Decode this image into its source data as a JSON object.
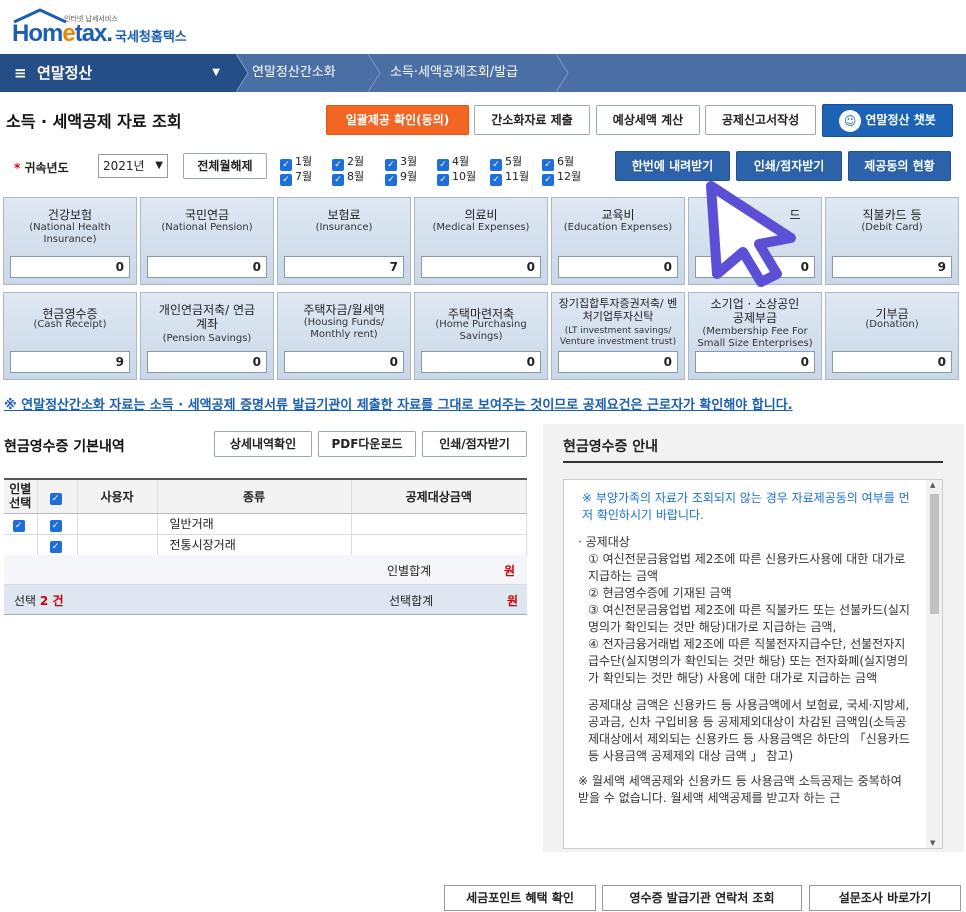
{
  "logo": {
    "brand_a": "Hom",
    "brand_e": "e",
    "brand_b": "tax.",
    "small": "인터넷 납세서비스",
    "kr": "국세청홈택스"
  },
  "nav": {
    "menu": "연말정산",
    "crumb1": "연말정산간소화",
    "crumb2": "소득·세액공제조회/발급"
  },
  "page": {
    "title": "소득 · 세액공제 자료 조회"
  },
  "top_buttons": {
    "consent": "일괄제공 확인(동의)",
    "submit": "간소화자료 제출",
    "estimate": "예상세액 계산",
    "form": "공제신고서작성",
    "chatbot": "연말정산 챗봇"
  },
  "filter": {
    "year_label": "귀속년도",
    "year_value": "2021년",
    "all_month": "전체월해제",
    "months": [
      "1월",
      "2월",
      "3월",
      "4월",
      "5월",
      "6월",
      "7월",
      "8월",
      "9월",
      "10월",
      "11월",
      "12월"
    ],
    "download": "한번에 내려받기",
    "print": "인쇄/점자받기",
    "provide": "제공동의 현황"
  },
  "cards": [
    {
      "kr": "건강보험",
      "en": "(National Health Insurance)",
      "value": "0"
    },
    {
      "kr": "국민연금",
      "en": "(National Pension)",
      "value": "0"
    },
    {
      "kr": "보험료",
      "en": "(Insurance)",
      "value": "7"
    },
    {
      "kr": "의료비",
      "en": "(Medical Expenses)",
      "value": "0"
    },
    {
      "kr": "교육비",
      "en": "(Education Expenses)",
      "value": "0"
    },
    {
      "kr": "드",
      "en": "",
      "value": "0"
    },
    {
      "kr": "직불카드 등",
      "en": "(Debit Card)",
      "value": "9"
    },
    {
      "kr": "현금영수증",
      "en": "(Cash Receipt)",
      "value": "9"
    },
    {
      "kr": "개인연금저축/ 연금계좌",
      "en": "(Pension Savings)",
      "value": "0"
    },
    {
      "kr": "주택자금/월세액",
      "en": "(Housing Funds/ Monthly rent)",
      "value": "0"
    },
    {
      "kr": "주택마련저축",
      "en": "(Home Purchasing Savings)",
      "value": "0"
    },
    {
      "kr": "장기집합투자증권저축/ 벤처기업투자신탁",
      "en": "(LT investment savings/ Venture investment trust)",
      "value": "0"
    },
    {
      "kr": "소기업 · 소상공인 공제부금",
      "en": "(Membership Fee For Small Size Enterprises)",
      "value": "0"
    },
    {
      "kr": "기부금",
      "en": "(Donation)",
      "value": "0"
    }
  ],
  "notice": "※ 연말정산간소화 자료는 소득 · 세액공제 증명서류 발급기관이 제출한 자료를 그대로 보여주는 것이므로 공제요건은 근로자가 확인해야 합니다.",
  "receipt": {
    "title": "현금영수증 기본내역",
    "detail_btn": "상세내역확인",
    "pdf_btn": "PDF다운로드",
    "print_btn": "인쇄/점자받기",
    "headers": {
      "per": "인별 선택",
      "user": "사용자",
      "type": "종류",
      "amount": "공제대상금액"
    },
    "rows": [
      {
        "type": "일반거래"
      },
      {
        "type": "전통시장거래"
      }
    ],
    "per_sum_label": "인별합계",
    "per_sum_unit": "원",
    "select_label": "선택",
    "select_count": "2 건",
    "select_sum_label": "선택합계",
    "select_sum_unit": "원"
  },
  "guide": {
    "title": "현금영수증 안내",
    "p1": "※ 부양가족의 자료가 조회되지 않는 경우 자료제공동의 여부를 먼저 확인하시기 바랍니다.",
    "head1": "공제대상",
    "i1": "① 여신전문금융업법 제2조에 따른 신용카드사용에 대한 대가로 지급하는 금액",
    "i2": "② 현금영수증에 기재된 금액",
    "i3": "③ 여신전문금융업법 제2조에 따른 직불카드 또는 선불카드(실지명의가 확인되는 것만 해당)대가로 지급하는 금액,",
    "i4": "④ 전자금융거래법 제2조에 따른 직불전자지급수단, 선불전자지급수단(실지명의가 확인되는 것만 해당) 또는 전자화폐(실지명의가 확인되는 것만 해당) 사용에 대한 대가로 지급하는 금액",
    "p2": "공제대상 금액은 신용카드 등 사용금액에서 보험료, 국세·지방세, 공과금, 신차 구입비용 등 공제제외대상이 차감된 금액임(소득공제대상에서 제외되는 신용카드 등 사용금액은 하단의 「신용카드 등 사용금액 공제제외 대상 금액 」 참고)",
    "p3": "※ 월세액 세액공제와 신용카드 등 사용금액 소득공제는 중복하여 받을 수 없습니다. 월세액 세액공제를 받고자 하는 근"
  },
  "bottom": {
    "b1": "세금포인트 혜택 확인",
    "b2": "영수증 발급기관 연락처 조회",
    "b3": "설문조사 바로가기"
  },
  "colors": {
    "navy": "#264e86",
    "orange": "#f26522",
    "blue": "#1d63b5",
    "cursor": "#5b4fd6"
  }
}
